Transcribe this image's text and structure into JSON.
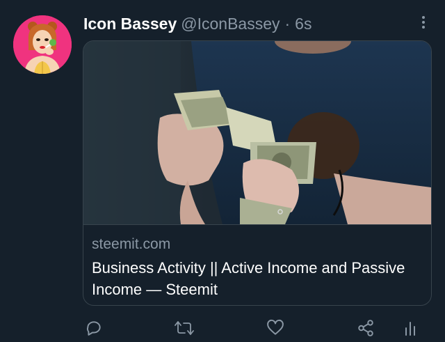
{
  "tweet": {
    "display_name": "Icon Bassey",
    "handle": "@IconBassey",
    "separator": "·",
    "time": "6s"
  },
  "card": {
    "domain": "steemit.com",
    "title": "Business Activity || Active Income and Passive Income — Steemit"
  },
  "icons": {
    "avatar": "avatar-illustration",
    "more": "more-vertical-icon",
    "reply": "reply-icon",
    "retweet": "retweet-icon",
    "like": "heart-icon",
    "share": "share-icon",
    "analytics": "analytics-icon"
  },
  "colors": {
    "background": "#15202b",
    "secondary_text": "#8b98a5",
    "border": "#38444d",
    "avatar_bg": "#f0337f"
  }
}
